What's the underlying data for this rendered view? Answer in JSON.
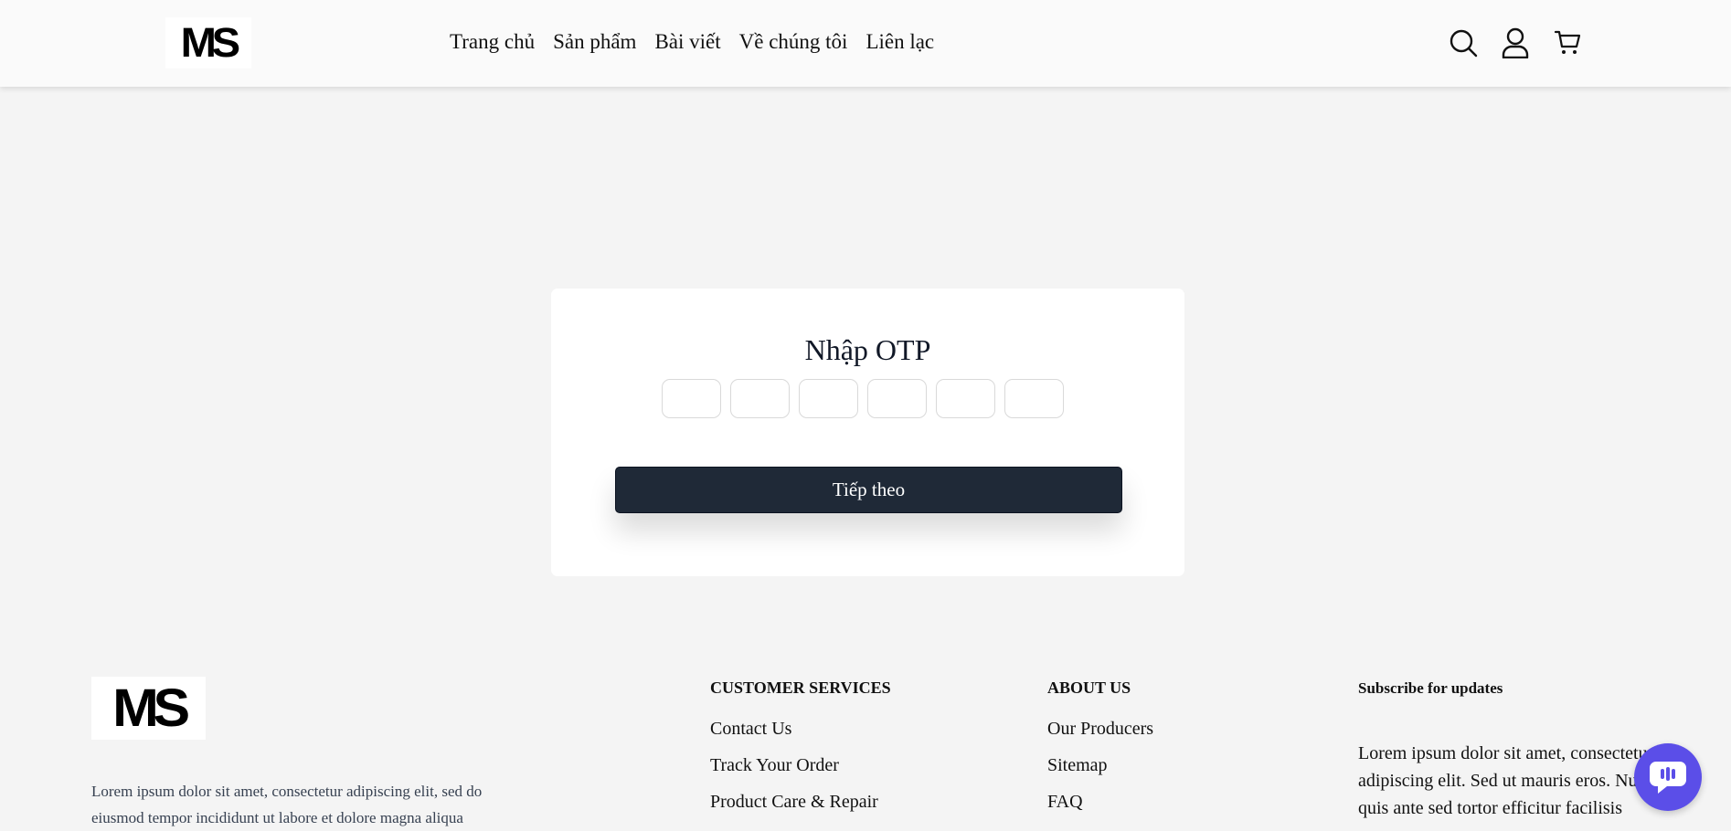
{
  "header": {
    "logo": "MS",
    "nav": [
      "Trang chủ",
      "Sản phẩm",
      "Bài viết",
      "Về chúng tôi",
      "Liên lạc"
    ],
    "icons": [
      "search-icon",
      "user-icon",
      "cart-icon"
    ]
  },
  "otp": {
    "title": "Nhập OTP",
    "digits": [
      "",
      "",
      "",
      "",
      "",
      ""
    ],
    "next_label": "Tiếp theo"
  },
  "footer": {
    "logo": "MS",
    "about": "Lorem ipsum dolor sit amet, consectetur adipiscing elit, sed do eiusmod tempor incididunt ut labore et dolore magna aliqua",
    "customer_services": {
      "heading": "CUSTOMER SERVICES",
      "links": [
        "Contact Us",
        "Track Your Order",
        "Product Care & Repair"
      ]
    },
    "about_us": {
      "heading": "ABOUT US",
      "links": [
        "Our Producers",
        "Sitemap",
        "FAQ"
      ]
    },
    "subscribe": {
      "heading": "Subscribe for updates",
      "text": "Lorem ipsum dolor sit amet, consectetur adipiscing elit. Sed ut mauris eros. Nulla quis ante sed tortor efficitur facilisis"
    }
  },
  "chat_icon": "chat-icon",
  "colors": {
    "button": "#1f2937",
    "chat": "#5b4ee8",
    "background": "#f4f4f4"
  }
}
